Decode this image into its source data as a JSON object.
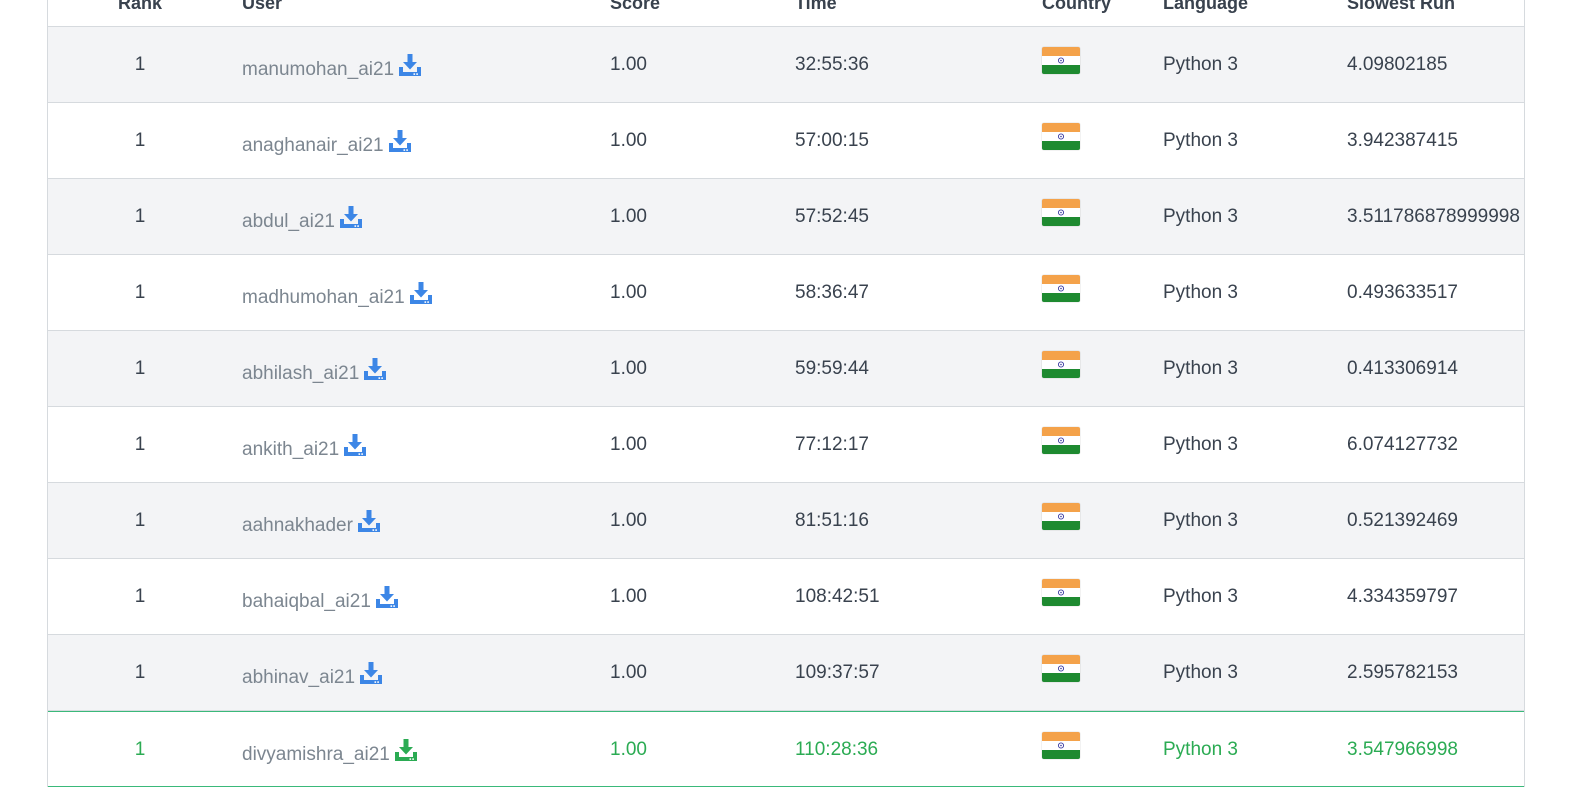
{
  "leaderboard": {
    "headers": {
      "rank": "Rank",
      "user": "User",
      "score": "Score",
      "time": "Time",
      "country": "Country",
      "language": "Language",
      "slowest_run": "Slowest Run"
    },
    "rows": [
      {
        "rank": "1",
        "user": "manumohan_ai21",
        "score": "1.00",
        "time": "32:55:36",
        "country": "India",
        "language": "Python 3",
        "slowest_run": "4.09802185",
        "highlight": false
      },
      {
        "rank": "1",
        "user": "anaghanair_ai21",
        "score": "1.00",
        "time": "57:00:15",
        "country": "India",
        "language": "Python 3",
        "slowest_run": "3.942387415",
        "highlight": false
      },
      {
        "rank": "1",
        "user": "abdul_ai21",
        "score": "1.00",
        "time": "57:52:45",
        "country": "India",
        "language": "Python 3",
        "slowest_run": "3.511786878999998",
        "highlight": false
      },
      {
        "rank": "1",
        "user": "madhumohan_ai21",
        "score": "1.00",
        "time": "58:36:47",
        "country": "India",
        "language": "Python 3",
        "slowest_run": "0.493633517",
        "highlight": false
      },
      {
        "rank": "1",
        "user": "abhilash_ai21",
        "score": "1.00",
        "time": "59:59:44",
        "country": "India",
        "language": "Python 3",
        "slowest_run": "0.413306914",
        "highlight": false
      },
      {
        "rank": "1",
        "user": "ankith_ai21",
        "score": "1.00",
        "time": "77:12:17",
        "country": "India",
        "language": "Python 3",
        "slowest_run": "6.074127732",
        "highlight": false
      },
      {
        "rank": "1",
        "user": "aahnakhader",
        "score": "1.00",
        "time": "81:51:16",
        "country": "India",
        "language": "Python 3",
        "slowest_run": "0.521392469",
        "highlight": false
      },
      {
        "rank": "1",
        "user": "bahaiqbal_ai21",
        "score": "1.00",
        "time": "108:42:51",
        "country": "India",
        "language": "Python 3",
        "slowest_run": "4.334359797",
        "highlight": false
      },
      {
        "rank": "1",
        "user": "abhinav_ai21",
        "score": "1.00",
        "time": "109:37:57",
        "country": "India",
        "language": "Python 3",
        "slowest_run": "2.595782153",
        "highlight": false
      },
      {
        "rank": "1",
        "user": "divyamishra_ai21",
        "score": "1.00",
        "time": "110:28:36",
        "country": "India",
        "language": "Python 3",
        "slowest_run": "3.547966998",
        "highlight": true
      }
    ]
  },
  "icons": {
    "download": "download-code-icon",
    "flag": "india-flag-icon"
  },
  "colors": {
    "download_blue": "#3c86e6",
    "download_green": "#2bab53",
    "highlight_text": "#2bab53",
    "highlight_border": "#3ab97a",
    "stripe": "#f3f4f6",
    "border": "#d6dade"
  }
}
